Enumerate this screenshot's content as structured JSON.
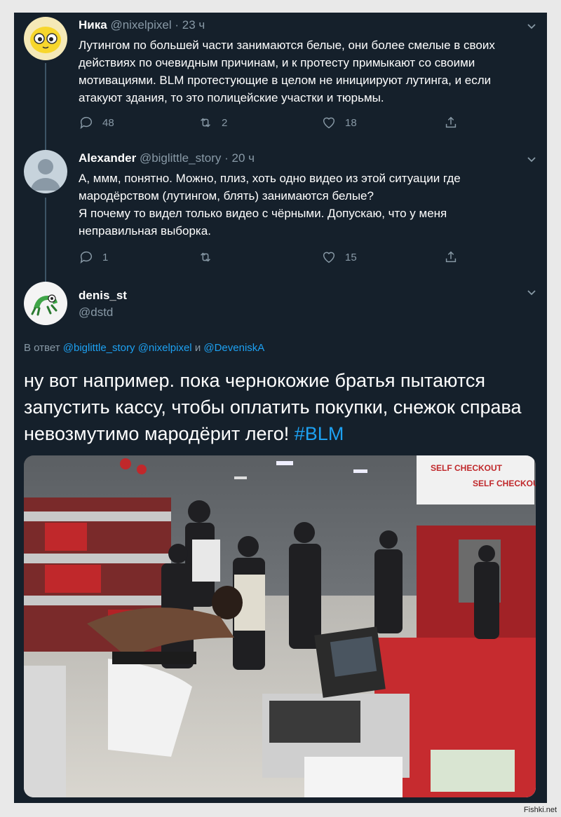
{
  "tweets": [
    {
      "name": "Ника",
      "handle": "@nixelpixel",
      "time": "· 23 ч",
      "text": "Лутингом по большей части занимаются белые, они более смелые в своих действиях по очевидным причинам, и к протесту примыкают со своими мотивациями. BLM протестующие в целом не инициируют лутинга, и если атакуют здания, то это полицейские участки и тюрьмы.",
      "replies": "48",
      "retweets": "2",
      "likes": "18"
    },
    {
      "name": "Alexander",
      "handle": "@biglittle_story",
      "time": "· 20 ч",
      "text": "А, ммм, понятно. Можно, плиз, хоть одно видео из этой ситуации где мародёрством (лутингом, блять) занимаются белые?\nЯ почему то видел только видео с чёрными. Допускаю, что у меня неправильная выборка.",
      "replies": "1",
      "retweets": "",
      "likes": "15"
    }
  ],
  "main": {
    "name": "denis_st",
    "handle": "@dstd",
    "reply_prefix": "В ответ",
    "reply_user1": "@biglittle_story",
    "reply_user2": "@nixelpixel",
    "reply_and": "и",
    "reply_user3": "@DeveniskA",
    "text": "ну вот например. пока чернокожие братья пытаются запустить кассу, чтобы оплатить покупки, снежок справа невозмутимо мародёрит лего!",
    "hashtag": "#BLM",
    "photo_signs": [
      "SELF CHECKOUT",
      "SELF CHECKOUT"
    ]
  },
  "watermark": "Fishki.net",
  "colors": {
    "background": "#15202b",
    "muted": "#8899a6",
    "link": "#1da1f2",
    "thread": "#3d5466"
  }
}
